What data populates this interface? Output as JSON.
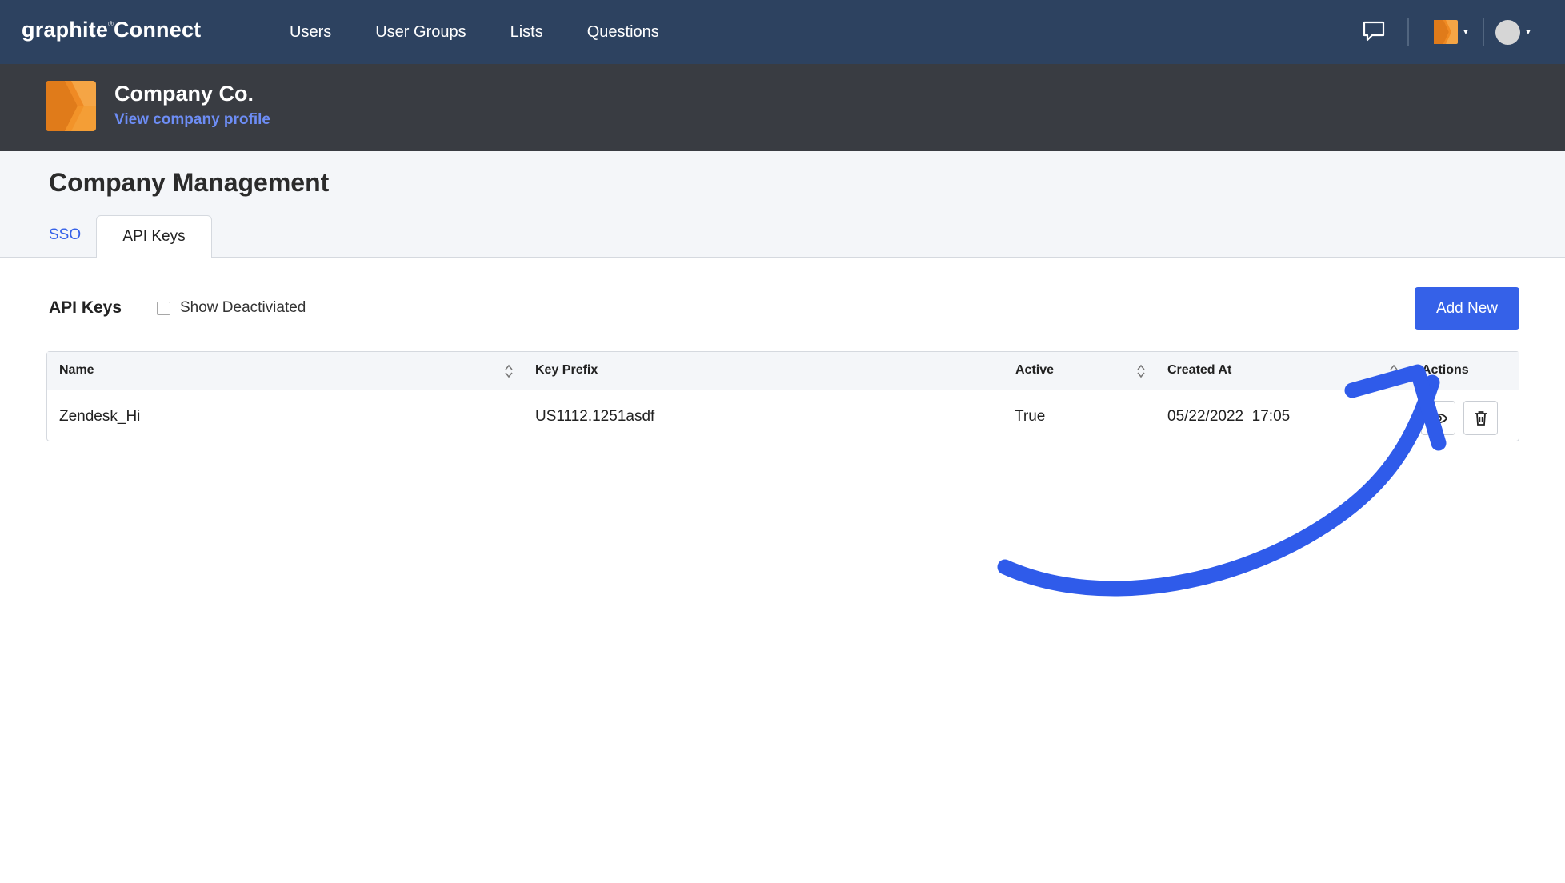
{
  "app": {
    "brand_prefix": "graphite",
    "brand_mark": "®",
    "brand_suffix": "Connect"
  },
  "nav": {
    "links": [
      "Users",
      "User Groups",
      "Lists",
      "Questions"
    ]
  },
  "company": {
    "name": "Company Co.",
    "profile_link": "View company profile"
  },
  "page": {
    "title": "Company Management",
    "tabs": [
      "SSO",
      "API Keys"
    ],
    "active_tab": "API Keys"
  },
  "api_keys": {
    "title": "API Keys",
    "show_deactivated_label": "Show Deactiviated",
    "show_deactivated_checked": false,
    "add_button": "Add New",
    "columns": [
      "Name",
      "Key Prefix",
      "Active",
      "Created At",
      "Actions"
    ],
    "rows": [
      {
        "name": "Zendesk_Hi",
        "key_prefix": "US1112.1251asdf",
        "active": "True",
        "created_at": "05/22/2022  17:05"
      }
    ]
  },
  "colors": {
    "nav_bg": "#2d4260",
    "banner_bg": "#393c42",
    "accent": "#3561e8",
    "link": "#6d8df5",
    "logo_orange": "#f39a2d",
    "annotation_arrow": "#2f5bea"
  }
}
